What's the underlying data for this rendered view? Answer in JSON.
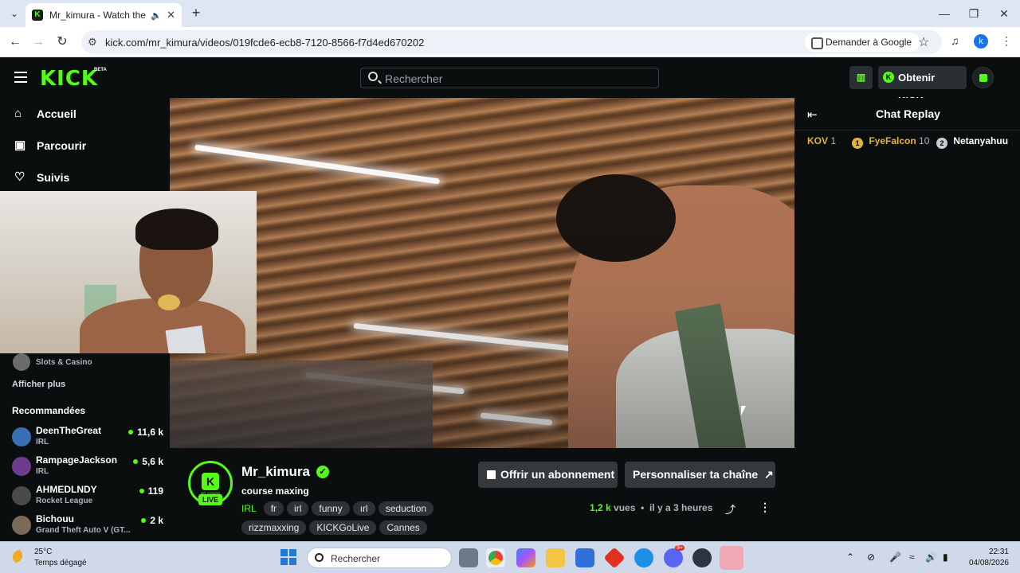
{
  "browser": {
    "tab_title": "Mr_kimura - Watch the VOD",
    "url": "kick.com/mr_kimura/videos/019fcde6-ecb8-7120-8566-f7d4ed670202",
    "ask_google": "Demander à Google",
    "profile_initial": "k"
  },
  "header": {
    "logo": "KICK",
    "beta": "BETA",
    "search_placeholder": "Rechercher",
    "get_kicks": "Obtenir KICKs"
  },
  "sidebar": {
    "nav": [
      {
        "label": "Accueil",
        "icon": "home-icon"
      },
      {
        "label": "Parcourir",
        "icon": "browse-icon"
      },
      {
        "label": "Suivis",
        "icon": "heart-icon"
      }
    ],
    "followed_partial_category": "Slots & Casino",
    "show_more": "Afficher plus",
    "recommended_title": "Recommandées",
    "recommended": [
      {
        "name": "DeenTheGreat",
        "category": "IRL",
        "viewers": "11,6 k"
      },
      {
        "name": "RampageJackson",
        "category": "IRL",
        "viewers": "5,6 k"
      },
      {
        "name": "AHMEDLNDY",
        "category": "Rocket League",
        "viewers": "119"
      },
      {
        "name": "Bichouu",
        "category": "Grand Theft Auto V (GT...",
        "viewers": "2 k"
      }
    ]
  },
  "chat": {
    "title": "Chat Replay",
    "gifters": [
      {
        "name": "KOV",
        "count": "1",
        "rank": ""
      },
      {
        "name": "FyeFalcon",
        "count": "10",
        "rank": "1"
      },
      {
        "name": "Netanyahuu",
        "count": "",
        "rank": "2"
      }
    ]
  },
  "stream": {
    "channel": "Mr_kimura",
    "avatar_sub": "MR_KIMURA",
    "live_badge": "LIVE",
    "title": "course maxing",
    "category": "IRL",
    "tags_row1": [
      "fr",
      "irl",
      "funny",
      "ırl",
      "seduction"
    ],
    "tags_row2": [
      "rizzmaxxing",
      "KICKGoLive",
      "Cannes"
    ],
    "subscribe_button": "Offrir un abonnement",
    "customize_button": "Personnaliser ta chaîne",
    "views": "1,2 k",
    "views_label": "vues",
    "bullet": "•",
    "ago": "il y a 3 heures"
  },
  "taskbar": {
    "temp": "25°C",
    "weather": "Temps dégagé",
    "search_placeholder": "Rechercher",
    "time": "22:31",
    "date": "04/08/2026",
    "discord_badge": "9+"
  },
  "colors": {
    "kick_green": "#53fc18",
    "bg": "#0b0e0f",
    "button_bg": "#35393c"
  }
}
